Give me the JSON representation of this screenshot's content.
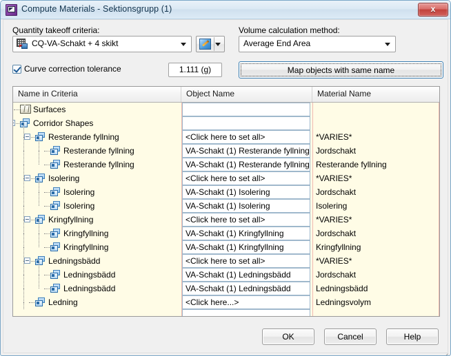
{
  "window": {
    "title": "Compute Materials - Sektionsgrupp (1)",
    "icon": "materials-dialog-icon",
    "close_label": "x",
    "accent_border": "#7aa7c7",
    "titlebar_text_color": "#13344e",
    "grid_background": "#fffce6",
    "grid_rule_color": "#f0b9b0"
  },
  "criteria": {
    "label": "Quantity takeoff criteria:",
    "value": "CQ-VA-Schakt + 4 skikt",
    "icon": "criteria-icon",
    "dropdown_icon": "chevron-down-icon",
    "edit_icon": "pencil-edit-icon",
    "edit_dropdown_icon": "chevron-down-icon"
  },
  "volume_method": {
    "label": "Volume calculation method:",
    "value": "Average End Area",
    "dropdown_icon": "chevron-down-icon"
  },
  "tolerance": {
    "checkbox_label": "Curve correction tolerance",
    "checked": true,
    "value": "1.111 (g)"
  },
  "map_button": {
    "label": "Map objects with same name"
  },
  "grid": {
    "columns": [
      "Name in Criteria",
      "Object Name",
      "Material Name"
    ],
    "rows": [
      {
        "name": "Surfaces",
        "indent": 0,
        "icon": "surface-icon",
        "expander": "none",
        "object": "",
        "object_box": true,
        "material": ""
      },
      {
        "name": "Corridor Shapes",
        "indent": 0,
        "icon": "corridor-shape-icon",
        "expander": "collapse",
        "object": "",
        "object_box": true,
        "material": ""
      },
      {
        "name": "Resterande fyllning",
        "indent": 1,
        "icon": "corridor-shape-icon",
        "expander": "collapse",
        "object": "<Click here to set all>",
        "object_box": true,
        "material": "*VARIES*"
      },
      {
        "name": "Resterande fyllning",
        "indent": 2,
        "icon": "corridor-shape-icon",
        "expander": "none",
        "object": "VA-Schakt (1) Resterande fyllning",
        "object_box": true,
        "material": "Jordschakt"
      },
      {
        "name": "Resterande fyllning",
        "indent": 2,
        "icon": "corridor-shape-icon",
        "expander": "none",
        "object": "VA-Schakt (1) Resterande fyllning",
        "object_box": true,
        "material": "Resterande fyllning"
      },
      {
        "name": "Isolering",
        "indent": 1,
        "icon": "corridor-shape-icon",
        "expander": "collapse",
        "object": "<Click here to set all>",
        "object_box": true,
        "material": "*VARIES*"
      },
      {
        "name": "Isolering",
        "indent": 2,
        "icon": "corridor-shape-icon",
        "expander": "none",
        "object": "VA-Schakt (1) Isolering",
        "object_box": true,
        "material": "Jordschakt"
      },
      {
        "name": "Isolering",
        "indent": 2,
        "icon": "corridor-shape-icon",
        "expander": "none",
        "object": "VA-Schakt (1) Isolering",
        "object_box": true,
        "material": "Isolering"
      },
      {
        "name": "Kringfyllning",
        "indent": 1,
        "icon": "corridor-shape-icon",
        "expander": "collapse",
        "object": "<Click here to set all>",
        "object_box": true,
        "material": "*VARIES*"
      },
      {
        "name": "Kringfyllning",
        "indent": 2,
        "icon": "corridor-shape-icon",
        "expander": "none",
        "object": "VA-Schakt (1) Kringfyllning",
        "object_box": true,
        "material": "Jordschakt"
      },
      {
        "name": "Kringfyllning",
        "indent": 2,
        "icon": "corridor-shape-icon",
        "expander": "none",
        "object": "VA-Schakt (1) Kringfyllning",
        "object_box": true,
        "material": "Kringfyllning"
      },
      {
        "name": "Ledningsbädd",
        "indent": 1,
        "icon": "corridor-shape-icon",
        "expander": "collapse",
        "object": "<Click here to set all>",
        "object_box": true,
        "material": "*VARIES*"
      },
      {
        "name": "Ledningsbädd",
        "indent": 2,
        "icon": "corridor-shape-icon",
        "expander": "none",
        "object": "VA-Schakt (1) Ledningsbädd",
        "object_box": true,
        "material": "Jordschakt"
      },
      {
        "name": "Ledningsbädd",
        "indent": 2,
        "icon": "corridor-shape-icon",
        "expander": "none",
        "object": "VA-Schakt (1) Ledningsbädd",
        "object_box": true,
        "material": "Ledningsbädd"
      },
      {
        "name": "Ledning",
        "indent": 1,
        "icon": "corridor-shape-icon",
        "expander": "none",
        "object": "<Click here...>",
        "object_box": true,
        "material": "Ledningsvolym"
      },
      {
        "name": "",
        "indent": 1,
        "icon": "none",
        "expander": "none",
        "object": "",
        "object_box": true,
        "material": ""
      }
    ]
  },
  "footer": {
    "ok_label": "OK",
    "cancel_label": "Cancel",
    "help_label": "Help"
  }
}
